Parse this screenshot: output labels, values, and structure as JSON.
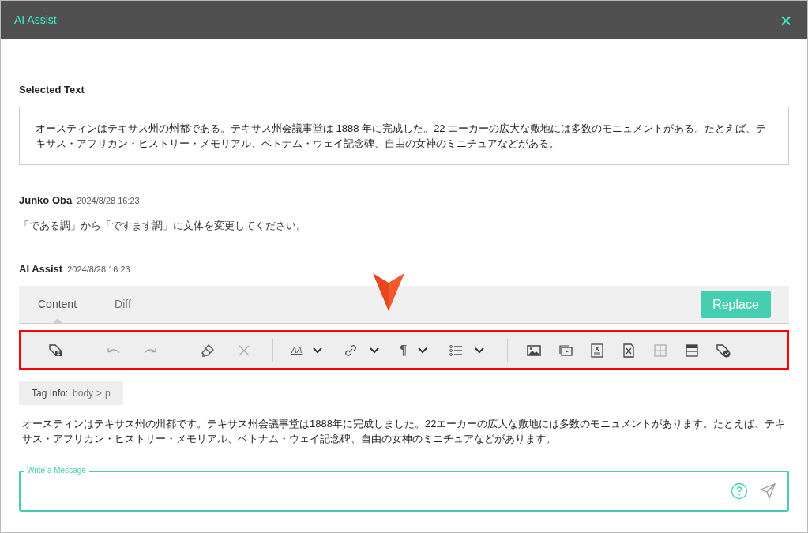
{
  "window": {
    "title": "AI Assist",
    "close": "×"
  },
  "selected_text": {
    "heading": "Selected Text",
    "body": "オースティンはテキサス州の州都である。テキサス州会議事堂は 1888 年に完成した。22 エーカーの広大な敷地には多数のモニュメントがある。たとえば、テキサス・アフリカン・ヒストリー・メモリアル、ベトナム・ウェイ記念碑、自由の女神のミニチュアなどがある。"
  },
  "messages": [
    {
      "author": "Junko Oba",
      "time": "2024/8/28 16:23",
      "body": "「である調」から「ですます調」に文体を変更してください。"
    },
    {
      "author": "AI Assist",
      "time": "2024/8/28 16:23"
    }
  ],
  "tabs": [
    {
      "label": "Content",
      "selected": true
    },
    {
      "label": "Diff",
      "selected": false
    }
  ],
  "replace_button": "Replace",
  "toolbar": [
    {
      "kind": "icon",
      "disabled": false
    },
    {
      "kind": "separator"
    },
    {
      "kind": "icon",
      "disabled": true
    },
    {
      "kind": "icon",
      "disabled": true
    },
    {
      "kind": "separator"
    },
    {
      "kind": "icon",
      "disabled": false
    },
    {
      "kind": "icon",
      "disabled": true
    },
    {
      "kind": "separator"
    },
    {
      "kind": "dropdown",
      "glyph": "AA"
    },
    {
      "kind": "dropdown"
    },
    {
      "kind": "dropdown",
      "glyph": "¶"
    },
    {
      "kind": "dropdown"
    },
    {
      "kind": "separator"
    },
    {
      "kind": "icon",
      "disabled": false
    },
    {
      "kind": "icon",
      "disabled": false
    },
    {
      "kind": "icon",
      "disabled": false
    },
    {
      "kind": "icon",
      "disabled": false
    },
    {
      "kind": "icon",
      "disabled": true
    },
    {
      "kind": "icon",
      "disabled": false
    },
    {
      "kind": "icon",
      "disabled": false
    }
  ],
  "tag_info": {
    "label": "Tag Info:",
    "path": [
      "body",
      ">",
      "p"
    ]
  },
  "result_text": "オースティンはテキサス州の州都です。テキサス州会議事堂は1888年に完成しました。22エーカーの広大な敷地には多数のモニュメントがあります。たとえば、テキサス・アフリカン・ヒストリー・メモリアル、ベトナム・ウェイ記念碑、自由の女神のミニチュアなどがあります。",
  "message_field": {
    "label": "Write a Message"
  }
}
